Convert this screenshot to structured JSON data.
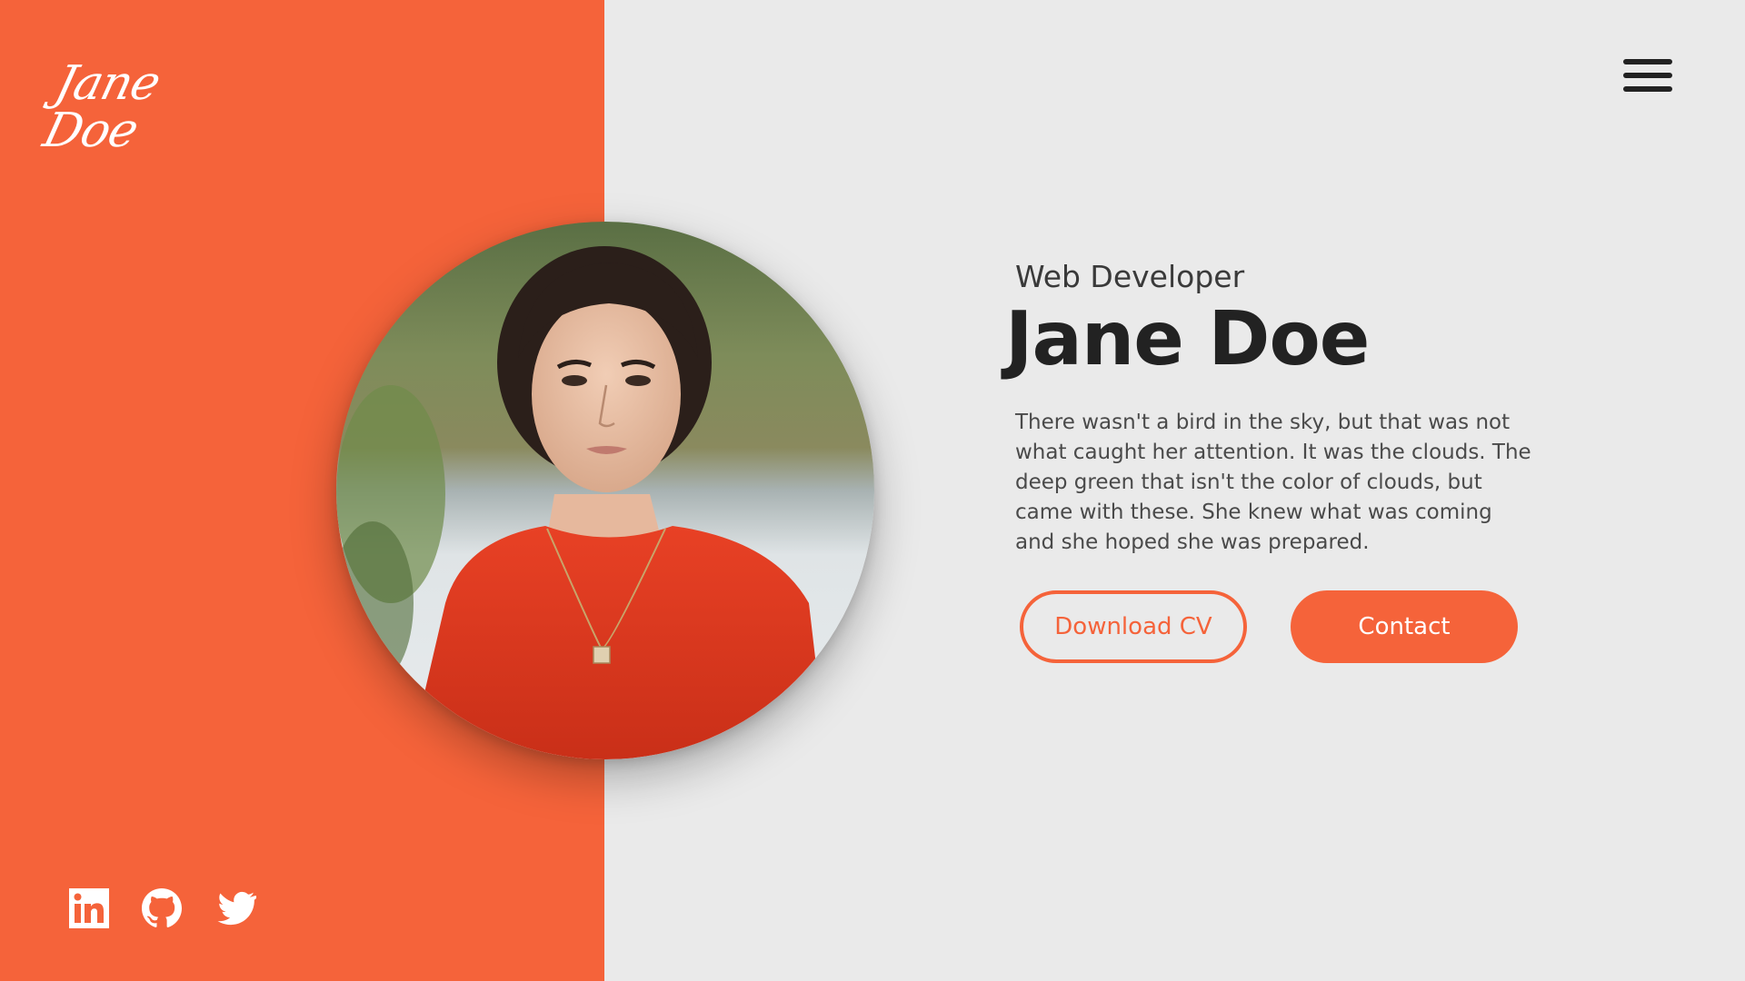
{
  "brand": {
    "logo_text": "Jane Doe"
  },
  "header": {
    "menu_icon": "hamburger-menu-icon"
  },
  "hero": {
    "role": "Web Developer",
    "name": "Jane Doe",
    "bio": "There wasn't a bird in the sky, but that was not what caught her attention. It was the clouds. The deep green that isn't the color of clouds, but came with these. She knew what was coming and she hoped she was prepared.",
    "primary_button_label": "Download CV",
    "secondary_button_label": "Contact"
  },
  "socials": [
    {
      "icon": "linkedin-icon"
    },
    {
      "icon": "github-icon"
    },
    {
      "icon": "twitter-icon"
    }
  ],
  "colors": {
    "accent": "#f5633a",
    "background": "#eaeaea",
    "text_dark": "#222222",
    "text_body": "#4a4a4a"
  }
}
